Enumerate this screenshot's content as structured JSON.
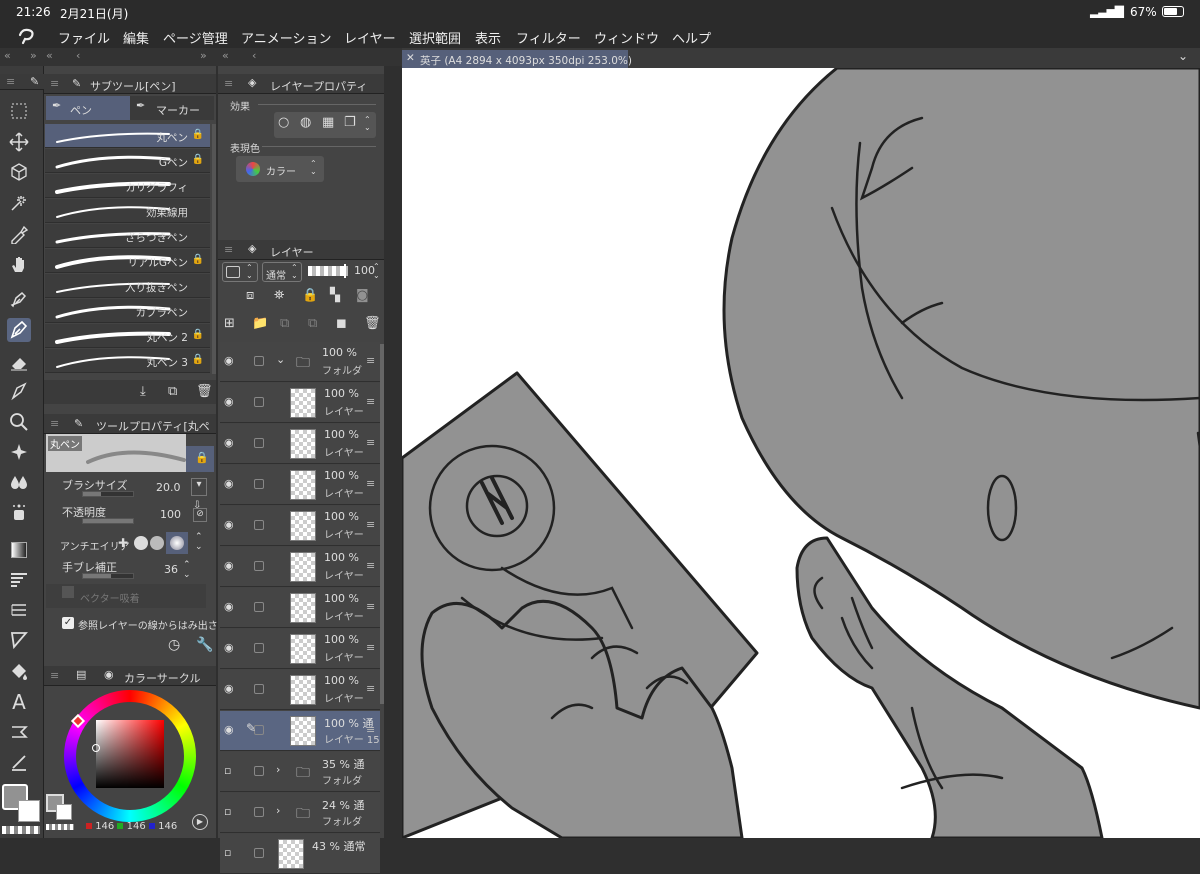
{
  "status": {
    "time": "21:26",
    "date": "2月21日(月)",
    "battery": "67%"
  },
  "menu": [
    "ファイル",
    "編集",
    "ページ管理",
    "アニメーション",
    "レイヤー",
    "選択範囲",
    "表示",
    "フィルター",
    "ウィンドウ",
    "ヘルプ"
  ],
  "subtool": {
    "title": "サブツール[ペン]",
    "tabs": [
      "ペン",
      "マーカー"
    ],
    "brushes": [
      {
        "name": "丸ペン",
        "locked": true,
        "selected": true
      },
      {
        "name": "Gペン",
        "locked": true
      },
      {
        "name": "カリグラフィ",
        "locked": false
      },
      {
        "name": "効果線用",
        "locked": false
      },
      {
        "name": "ざらつきペン",
        "locked": false
      },
      {
        "name": "リアルGペン",
        "locked": true
      },
      {
        "name": "入り抜きペン",
        "locked": false
      },
      {
        "name": "カブラペン",
        "locked": false
      },
      {
        "name": "丸ペン 2",
        "locked": true
      },
      {
        "name": "丸ペン 3",
        "locked": true
      }
    ]
  },
  "layer_props": {
    "title": "レイヤープロパティ",
    "effect_label": "効果",
    "color_label": "表現色",
    "color_value": "カラー"
  },
  "layers": {
    "title": "レイヤー",
    "blend": "通常",
    "opacity": "100",
    "rows": [
      {
        "pct": "100 %",
        "name": "フォルダ",
        "type": "folder",
        "open": true
      },
      {
        "pct": "100 %",
        "name": "レイヤー",
        "type": "layer"
      },
      {
        "pct": "100 %",
        "name": "レイヤー",
        "type": "layer"
      },
      {
        "pct": "100 %",
        "name": "レイヤー",
        "type": "layer"
      },
      {
        "pct": "100 %",
        "name": "レイヤー",
        "type": "layer"
      },
      {
        "pct": "100 %",
        "name": "レイヤー",
        "type": "layer"
      },
      {
        "pct": "100 %",
        "name": "レイヤー",
        "type": "layer"
      },
      {
        "pct": "100 %",
        "name": "レイヤー",
        "type": "layer"
      },
      {
        "pct": "100 %",
        "name": "レイヤー",
        "type": "layer"
      },
      {
        "pct": "100 % 通",
        "name": "レイヤー 15",
        "type": "layer",
        "selected": true
      },
      {
        "pct": "35 % 通",
        "name": "フォルダ",
        "type": "folder"
      },
      {
        "pct": "24 % 通",
        "name": "フォルダ",
        "type": "folder"
      },
      {
        "pct": "43 % 通常",
        "name": "",
        "type": "layer"
      }
    ]
  },
  "toolprop": {
    "title": "ツールプロパティ[丸ペン]",
    "preview_name": "丸ペン",
    "brush_size_label": "ブラシサイズ",
    "brush_size": "20.0",
    "opacity_label": "不透明度",
    "opacity": "100",
    "antialias_label": "アンチエイリア",
    "stabilize_label": "手ブレ補正",
    "stabilize": "36",
    "vector_label": "ベクター吸着",
    "ref_label": "参照レイヤーの線からはみ出さない",
    "brush_size_level": 0.35,
    "opacity_level": 1.0,
    "stabilize_level": 0.55
  },
  "color": {
    "title": "カラーサークル",
    "r": "146",
    "g": "146",
    "b": "146",
    "main": "#929292"
  },
  "canvas": {
    "tab_title": "英子 (A4 2894 x 4093px 350dpi 253.0%)"
  }
}
